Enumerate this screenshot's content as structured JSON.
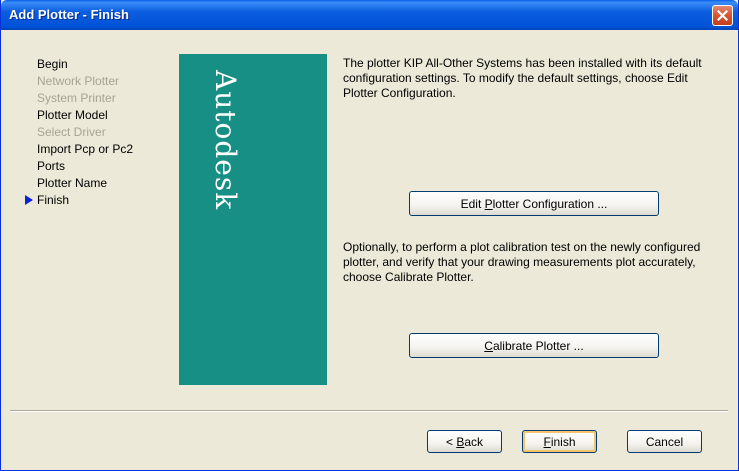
{
  "window": {
    "title": "Add Plotter - Finish"
  },
  "steps": [
    {
      "label": "Begin",
      "state": "normal"
    },
    {
      "label": "Network Plotter",
      "state": "disabled"
    },
    {
      "label": "System Printer",
      "state": "disabled"
    },
    {
      "label": "Plotter Model",
      "state": "normal"
    },
    {
      "label": "Select Driver",
      "state": "disabled"
    },
    {
      "label": "Import Pcp or Pc2",
      "state": "normal"
    },
    {
      "label": "Ports",
      "state": "normal"
    },
    {
      "label": "Plotter Name",
      "state": "normal"
    },
    {
      "label": "Finish",
      "state": "active"
    }
  ],
  "brand": {
    "text": "Autodesk",
    "color": "#178f84"
  },
  "info": {
    "paragraph1": "The plotter KIP All-Other Systems has been installed with its default configuration settings.  To modify the default settings, choose Edit Plotter Configuration.",
    "paragraph2": "Optionally, to perform a plot calibration test on the newly configured plotter, and verify that your drawing measurements plot accurately, choose Calibrate Plotter."
  },
  "buttons": {
    "edit_prefix": "Edit ",
    "edit_mnemonic": "P",
    "edit_suffix": "lotter Configuration ...",
    "cal_mnemonic": "C",
    "cal_suffix": "alibrate Plotter ...",
    "back_prefix": "< ",
    "back_mnemonic": "B",
    "back_suffix": "ack",
    "finish_mnemonic": "F",
    "finish_suffix": "inish",
    "cancel": "Cancel"
  }
}
